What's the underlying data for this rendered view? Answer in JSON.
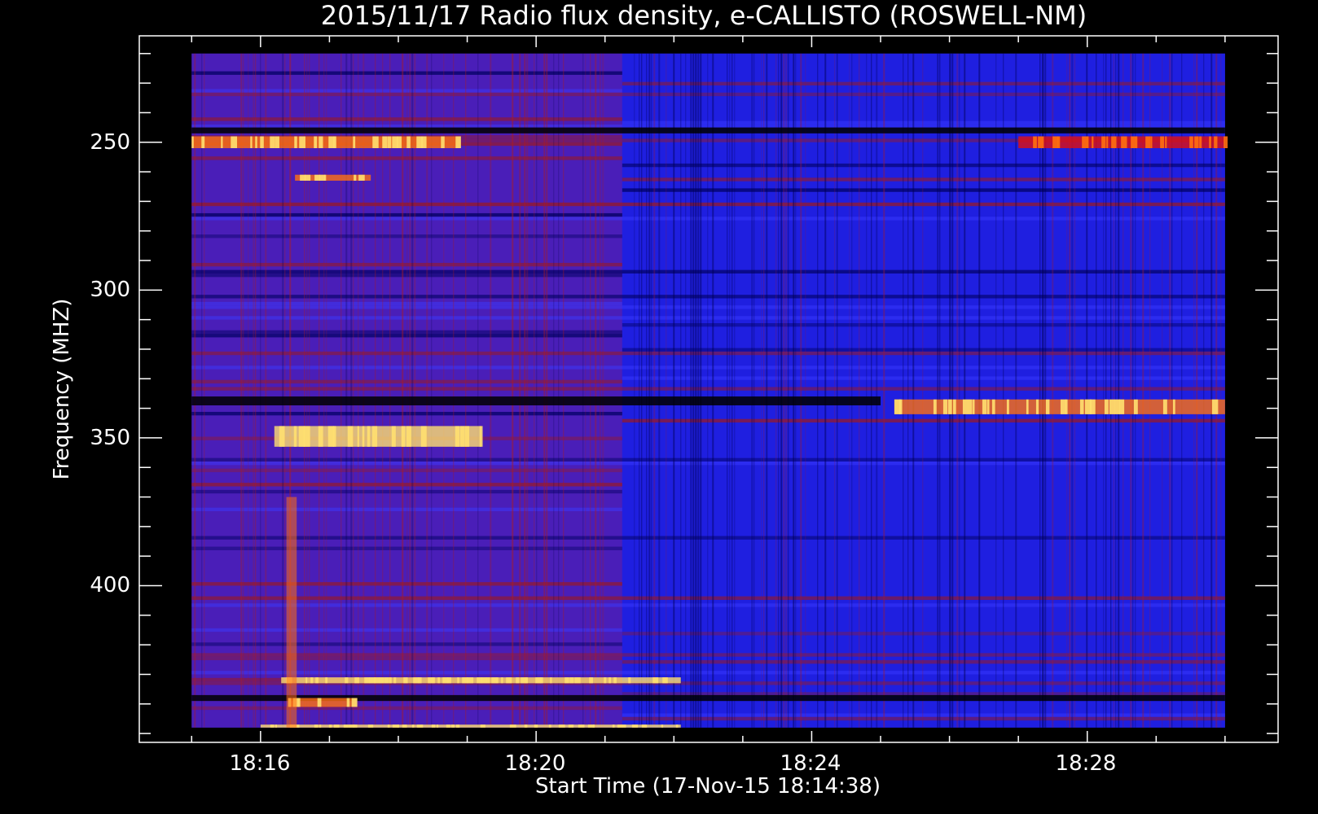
{
  "chart_data": {
    "type": "heatmap",
    "title": "2015/11/17  Radio flux density, e-CALLISTO (ROSWELL-NM)",
    "xlabel": "Start Time (17-Nov-15 18:14:38)",
    "ylabel": "Frequency (MHZ)",
    "x_tick_labels": [
      "18:16",
      "18:20",
      "18:24",
      "18:28"
    ],
    "x_ticks_minutes": [
      16,
      20,
      24,
      28
    ],
    "y_tick_labels": [
      "250",
      "300",
      "350",
      "400"
    ],
    "y_ticks": [
      250,
      300,
      350,
      400
    ],
    "xlim_minutes": [
      14.24,
      30.77
    ],
    "ylim": [
      214,
      453
    ],
    "y_inverted": true,
    "data_extent": {
      "x_minutes": [
        15.0,
        30.0
      ],
      "y_mhz": [
        220,
        448
      ]
    },
    "colormap": [
      "#000000",
      "#1010d8",
      "#2222ff",
      "#8c1818",
      "#e01010",
      "#ff7010",
      "#ffe070"
    ],
    "regime_change_minute": 21.25,
    "bands": [
      {
        "f0": 245,
        "f1": 247,
        "x0": 15.0,
        "x1": 30.0,
        "level": 0.0
      },
      {
        "f0": 248,
        "f1": 252,
        "x0": 15.0,
        "x1": 18.9,
        "level": 0.85
      },
      {
        "f0": 248,
        "f1": 252,
        "x0": 27.0,
        "x1": 30.0,
        "level": 0.6
      },
      {
        "f0": 261,
        "f1": 263,
        "x0": 16.5,
        "x1": 17.6,
        "level": 0.8
      },
      {
        "f0": 336,
        "f1": 339,
        "x0": 15.0,
        "x1": 25.0,
        "level": 0.0
      },
      {
        "f0": 337,
        "f1": 342,
        "x0": 25.2,
        "x1": 30.0,
        "level": 0.85
      },
      {
        "f0": 346,
        "f1": 353,
        "x0": 16.2,
        "x1": 19.2,
        "level": 0.95
      },
      {
        "f0": 431,
        "f1": 433,
        "x0": 16.3,
        "x1": 22.1,
        "level": 1.0
      },
      {
        "f0": 437,
        "f1": 439,
        "x0": 15.0,
        "x1": 30.0,
        "level": 0.0
      },
      {
        "f0": 438,
        "f1": 441,
        "x0": 16.4,
        "x1": 17.4,
        "level": 0.9
      },
      {
        "f0": 447,
        "f1": 448,
        "x0": 16.0,
        "x1": 22.1,
        "level": 0.95
      }
    ],
    "burst_columns": [
      {
        "x": 16.45,
        "width": 0.15,
        "f0": 370,
        "f1": 448,
        "level": 0.8
      }
    ]
  }
}
